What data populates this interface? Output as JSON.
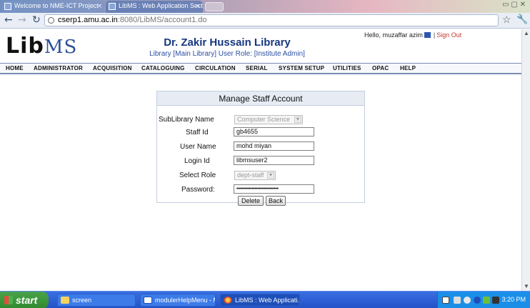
{
  "browser": {
    "tabs": [
      {
        "label": "Welcome to NME-ICT Project : ..."
      },
      {
        "label": "LibMS : Web Application Sect..."
      }
    ],
    "url_host": "cserp1.amu.ac.in",
    "url_path": ":8080/LibMS/account1.do"
  },
  "header": {
    "logo_main": "Lib",
    "logo_suffix": "MS",
    "title": "Dr. Zakir Hussain Library",
    "subtitle": "Library [Main Library]  User Role: [Institute Admin]",
    "greeting": "Hello,  muzaffar azim",
    "signout": "Sign Out"
  },
  "menu": [
    "HOME",
    "ADMINISTRATOR",
    "ACQUISITION",
    "CATALOGUING",
    "CIRCULATION",
    "SERIAL",
    "SYSTEM SETUP",
    "UTILITIES",
    "OPAC",
    "HELP"
  ],
  "form": {
    "title": "Manage Staff Account",
    "sublibrary_label": "SubLibrary Name",
    "sublibrary_value": "Computer Science",
    "staff_id_label": "Staff Id",
    "staff_id_value": "gb4655",
    "user_name_label": "User Name",
    "user_name_value": "mohd miyan",
    "login_id_label": "Login Id",
    "login_id_value": "libmsuser2",
    "role_label": "Select Role",
    "role_value": "dept-staff",
    "password_label": "Password:",
    "password_value": "••••••••••••••••••••••••••••••",
    "delete_label": "Delete",
    "back_label": "Back"
  },
  "taskbar": {
    "start": "start",
    "tasks": [
      "screen",
      "modulerHelpMenu - M...",
      "LibMS : Web Applicati..."
    ],
    "clock": "3:20 PM"
  }
}
